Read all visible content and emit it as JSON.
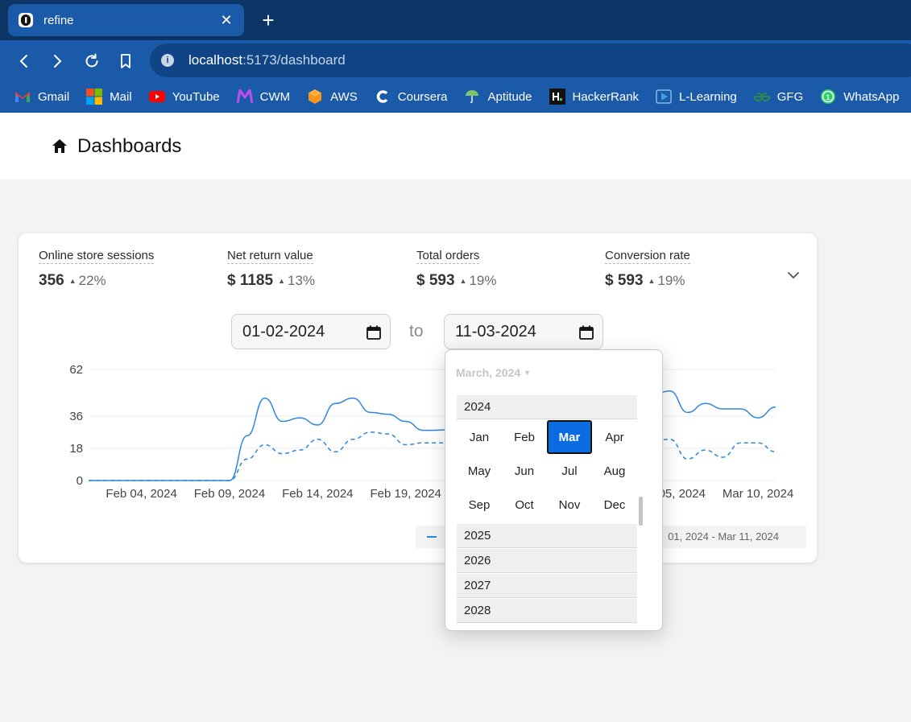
{
  "browser": {
    "tab_title": "refine",
    "url_host": "localhost",
    "url_path": ":5173/dashboard",
    "bookmarks": [
      {
        "label": "Gmail",
        "icon": "gmail-icon",
        "color": "#ea4335"
      },
      {
        "label": "Mail",
        "icon": "microsoft-icon",
        "color": "#f25022"
      },
      {
        "label": "YouTube",
        "icon": "youtube-icon",
        "color": "#ff0000"
      },
      {
        "label": "CWM",
        "icon": "cwm-icon",
        "color": "#b84df0"
      },
      {
        "label": "AWS",
        "icon": "aws-icon",
        "color": "#f7931e"
      },
      {
        "label": "Coursera",
        "icon": "coursera-icon",
        "color": "#ffffff"
      },
      {
        "label": "Aptitude",
        "icon": "aptitude-icon",
        "color": "#7cc46a"
      },
      {
        "label": "HackerRank",
        "icon": "hackerrank-icon",
        "color": "#111111"
      },
      {
        "label": "L-Learning",
        "icon": "linkedin-learning-icon",
        "color": "#3aa0e0"
      },
      {
        "label": "GFG",
        "icon": "gfg-icon",
        "color": "#2f8d46"
      },
      {
        "label": "WhatsApp",
        "icon": "whatsapp-icon",
        "color": "#25d366"
      }
    ]
  },
  "page": {
    "title": "Dashboards"
  },
  "metrics": [
    {
      "label": "Online store sessions",
      "value": "356",
      "trend": "22%"
    },
    {
      "label": "Net return value",
      "value": "$ 1185",
      "trend": "13%"
    },
    {
      "label": "Total orders",
      "value": "$ 593",
      "trend": "19%"
    },
    {
      "label": "Conversion rate",
      "value": "$ 593",
      "trend": "19%"
    }
  ],
  "date_range": {
    "start": "01-02-2024",
    "to_label": "to",
    "end": "11-03-2024"
  },
  "legend": {
    "range_text": "01, 2024 - Mar 11, 2024"
  },
  "picker": {
    "header": "March, 2024",
    "current_year": "2024",
    "months": [
      "Jan",
      "Feb",
      "Mar",
      "Apr",
      "May",
      "Jun",
      "Jul",
      "Aug",
      "Sep",
      "Oct",
      "Nov",
      "Dec"
    ],
    "selected_month": "Mar",
    "other_years": [
      "2025",
      "2026",
      "2027",
      "2028"
    ]
  },
  "chart_data": {
    "type": "line",
    "y_ticks": [
      "62",
      "36",
      "18",
      "0"
    ],
    "x_tick_labels": [
      "Feb 04, 2024",
      "Feb 09, 2024",
      "Feb 14, 2024",
      "Feb 19, 2024",
      "Mar 05, 2024",
      "Mar 10, 2024"
    ],
    "ylim": [
      0,
      62
    ],
    "grid": true,
    "series": [
      {
        "style": "solid",
        "color": "#2e86de",
        "x": [
          "Feb 01",
          "Feb 09",
          "Feb 10",
          "Feb 11",
          "Feb 12",
          "Feb 13",
          "Feb 14",
          "Feb 15",
          "Feb 16",
          "Feb 17",
          "Feb 18",
          "Feb 19",
          "Feb 20",
          "Mar 04",
          "Mar 05",
          "Mar 06",
          "Mar 07",
          "Mar 08",
          "Mar 09",
          "Mar 10",
          "Mar 11"
        ],
        "values": [
          0,
          0,
          25,
          46,
          33,
          35,
          31,
          43,
          46,
          38,
          37,
          33,
          28,
          48,
          50,
          38,
          43,
          40,
          40,
          35,
          41
        ]
      },
      {
        "style": "dashed",
        "color": "#2e86de",
        "x": [
          "Feb 01",
          "Feb 09",
          "Feb 10",
          "Feb 11",
          "Feb 12",
          "Feb 13",
          "Feb 14",
          "Feb 15",
          "Feb 16",
          "Feb 17",
          "Feb 18",
          "Feb 19",
          "Feb 20",
          "Mar 04",
          "Mar 05",
          "Mar 06",
          "Mar 07",
          "Mar 08",
          "Mar 09",
          "Mar 10",
          "Mar 11"
        ],
        "values": [
          0,
          0,
          12,
          20,
          15,
          17,
          23,
          16,
          23,
          27,
          26,
          20,
          21,
          22,
          23,
          12,
          17,
          13,
          21,
          21,
          16
        ]
      }
    ]
  }
}
